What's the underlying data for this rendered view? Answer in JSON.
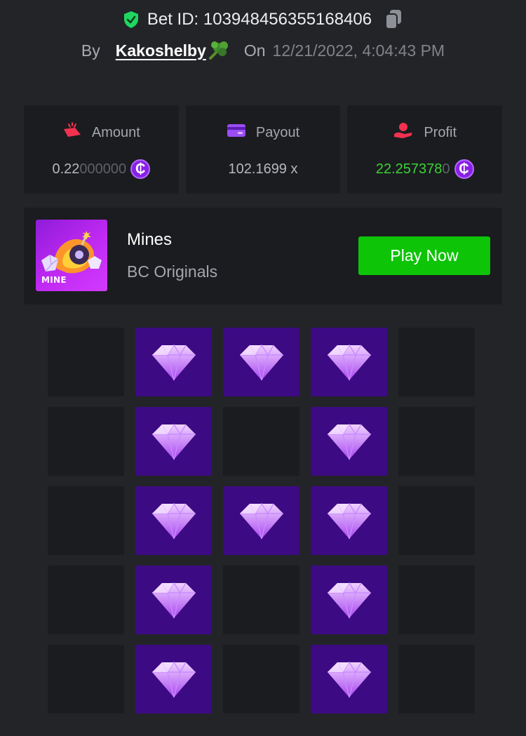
{
  "header": {
    "bet_id": "Bet ID: 103948456355168406",
    "by_label": "By",
    "username": "Kakoshelby",
    "on_label": "On",
    "date": "12/21/2022, 4:04:43 PM",
    "icons": [
      "shield-check-icon",
      "copy-icon",
      "broccoli-icon"
    ],
    "shield_color": "#1ed760"
  },
  "stats": {
    "amount": {
      "label": "Amount",
      "value_main": "0.22",
      "value_dim": "000000",
      "icon": "amount-icon",
      "icon_color": "#f0324e"
    },
    "payout": {
      "label": "Payout",
      "value": "102.1699 x",
      "icon": "card-icon",
      "icon_color": "#9b4df5"
    },
    "profit": {
      "label": "Profit",
      "value_main": "22.257378",
      "value_dim": "0",
      "icon": "profit-icon",
      "icon_color": "#f0324e",
      "value_color": "#39d434"
    },
    "coin_symbol": "₵",
    "coin_color": "#8a20e6"
  },
  "game": {
    "thumb_label": "MINE",
    "title": "Mines",
    "subtitle": "BC Originals",
    "play_label": "Play Now",
    "play_color": "#0dc407"
  },
  "grid": {
    "cols": 5,
    "rows": 5,
    "tiles": [
      "empty",
      "gem",
      "gem",
      "gem",
      "empty",
      "empty",
      "gem",
      "empty",
      "gem",
      "empty",
      "empty",
      "gem",
      "gem",
      "gem",
      "empty",
      "empty",
      "gem",
      "empty",
      "gem",
      "empty",
      "empty",
      "gem",
      "empty",
      "gem",
      "empty"
    ],
    "gem_tile_color": "#3c0a82",
    "empty_tile_color": "#1b1c1f"
  }
}
